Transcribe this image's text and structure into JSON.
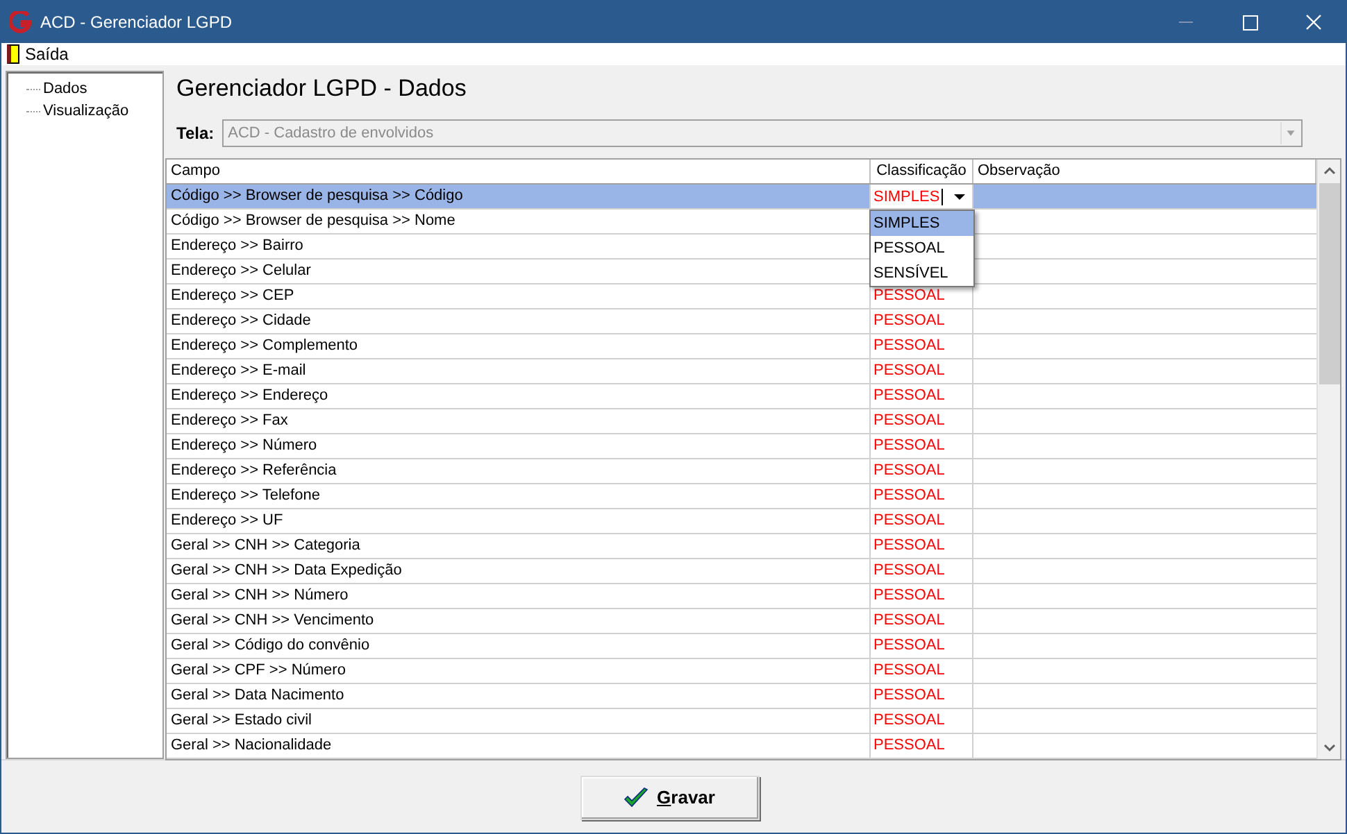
{
  "window": {
    "title": "ACD - Gerenciador LGPD"
  },
  "menu": [
    {
      "label": "Saída"
    }
  ],
  "tree": [
    {
      "label": "Dados"
    },
    {
      "label": "Visualização"
    }
  ],
  "heading": "Gerenciador LGPD - Dados",
  "tela": {
    "label": "Tela:",
    "value": "ACD - Cadastro de envolvidos",
    "disabled": true
  },
  "table": {
    "columns": [
      "Campo",
      "Classificação",
      "Observação"
    ],
    "rows": [
      {
        "campo": "Código >> Browser de pesquisa >> Código",
        "classificacao": "SIMPLES",
        "selected": true,
        "editing": true
      },
      {
        "campo": "Código >> Browser de pesquisa >> Nome",
        "selected": false
      },
      {
        "campo": "Endereço >> Bairro",
        "selected": false
      },
      {
        "campo": "Endereço >> Celular",
        "selected": false
      },
      {
        "campo": "Endereço >> CEP",
        "classificacao": "PESSOAL",
        "selected": false
      },
      {
        "campo": "Endereço >> Cidade",
        "classificacao": "PESSOAL",
        "selected": false
      },
      {
        "campo": "Endereço >> Complemento",
        "classificacao": "PESSOAL",
        "selected": false
      },
      {
        "campo": "Endereço >> E-mail",
        "classificacao": "PESSOAL",
        "selected": false
      },
      {
        "campo": "Endereço >> Endereço",
        "classificacao": "PESSOAL",
        "selected": false
      },
      {
        "campo": "Endereço >> Fax",
        "classificacao": "PESSOAL",
        "selected": false
      },
      {
        "campo": "Endereço >> Número",
        "classificacao": "PESSOAL",
        "selected": false
      },
      {
        "campo": "Endereço >> Referência",
        "classificacao": "PESSOAL",
        "selected": false
      },
      {
        "campo": "Endereço >> Telefone",
        "classificacao": "PESSOAL",
        "selected": false
      },
      {
        "campo": "Endereço >> UF",
        "classificacao": "PESSOAL",
        "selected": false
      },
      {
        "campo": "Geral >> CNH >> Categoria",
        "classificacao": "PESSOAL",
        "selected": false
      },
      {
        "campo": "Geral >> CNH >> Data Expedição",
        "classificacao": "PESSOAL",
        "selected": false
      },
      {
        "campo": "Geral >> CNH >> Número",
        "classificacao": "PESSOAL",
        "selected": false
      },
      {
        "campo": "Geral >> CNH >> Vencimento",
        "classificacao": "PESSOAL",
        "selected": false
      },
      {
        "campo": "Geral >> Código do convênio",
        "classificacao": "PESSOAL",
        "selected": false
      },
      {
        "campo": "Geral >> CPF >> Número",
        "classificacao": "PESSOAL",
        "selected": false
      },
      {
        "campo": "Geral >> Data Nacimento",
        "classificacao": "PESSOAL",
        "selected": false
      },
      {
        "campo": "Geral >> Estado civil",
        "classificacao": "PESSOAL",
        "selected": false
      },
      {
        "campo": "Geral >> Nacionalidade",
        "classificacao": "PESSOAL",
        "selected": false
      }
    ]
  },
  "dropdown": {
    "options": [
      {
        "label": "SIMPLES",
        "selected": true
      },
      {
        "label": "PESSOAL",
        "selected": false
      },
      {
        "label": "SENSÍVEL",
        "selected": false
      }
    ]
  },
  "save_button": {
    "label": "Gravar",
    "accelerator_underlined": true
  }
}
